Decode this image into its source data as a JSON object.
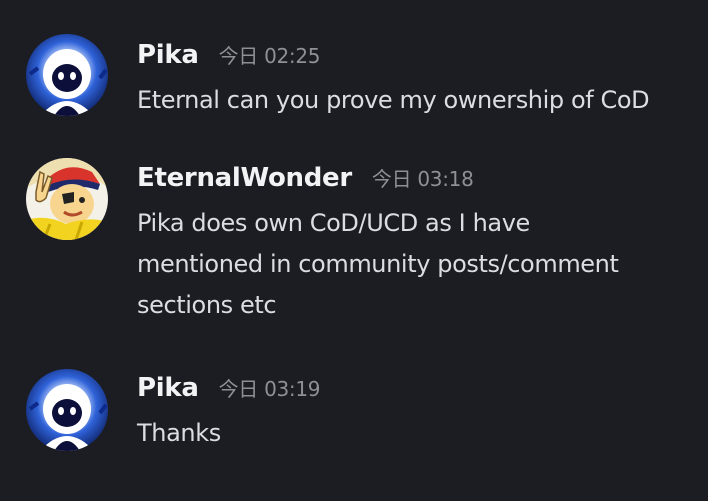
{
  "messages": [
    {
      "author": "Pika",
      "timestamp": "今日 02:25",
      "lines": [
        "Eternal can you prove my ownership of CoD"
      ]
    },
    {
      "author": "EternalWonder",
      "timestamp": "今日 03:18",
      "lines": [
        "Pika does own CoD/UCD as I have",
        "mentioned in community posts/comment",
        "sections etc"
      ]
    },
    {
      "author": "Pika",
      "timestamp": "今日 03:19",
      "lines": [
        "Thanks"
      ]
    }
  ],
  "colors": {
    "background": "#1c1d22",
    "username": "#f2f3f5",
    "timestamp": "#8e9097",
    "message_text": "#dcdde2"
  },
  "icons": {
    "pika_avatar": "blue-hooded-figure-avatar",
    "eternalwonder_avatar": "cartoon-boy-peace-sign-avatar"
  }
}
